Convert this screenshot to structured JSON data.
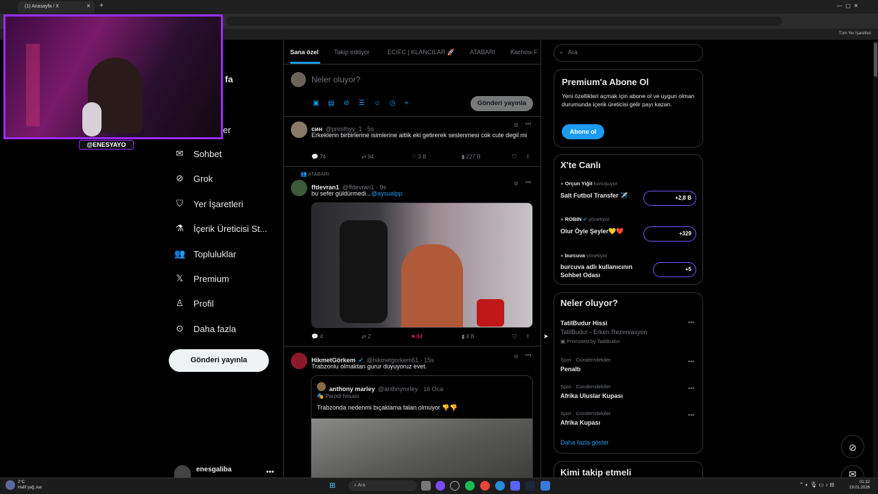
{
  "browser": {
    "tab_title": "(1) Anasayfa / X",
    "bookmarks_label": "Tüm Yer İşaretleri"
  },
  "stream": {
    "cam_name": "@ENESYAYO"
  },
  "sidebar": {
    "partial_home": "fa",
    "partial_notifications": "er",
    "items": [
      {
        "label": "Sohbet",
        "icon": "mail-icon"
      },
      {
        "label": "Grok",
        "icon": "grok-icon"
      },
      {
        "label": "Yer İşaretleri",
        "icon": "bookmark-icon"
      },
      {
        "label": "İçerik Üreticisi St...",
        "icon": "flask-icon"
      },
      {
        "label": "Topluluklar",
        "icon": "people-icon"
      },
      {
        "label": "Premium",
        "icon": "x-icon"
      },
      {
        "label": "Profil",
        "icon": "person-icon"
      },
      {
        "label": "Daha fazla",
        "icon": "more-circle-icon"
      }
    ],
    "post_button": "Gönderi yayınla",
    "account_name": "enesgaliba"
  },
  "feed": {
    "tabs": [
      "Sana özel",
      "Takip ediliyor",
      "ECIFC | KLANCILAR 🚀",
      "ATABARI",
      "Kachow F"
    ],
    "compose_placeholder": "Neler oluyor?",
    "compose_button": "Gönderi yayınla",
    "tweets": [
      {
        "name": "син",
        "handle": "@presthyy_1 · 5s",
        "text": "Erkeklerin birbirlerine isimlerine aitlik eki getirerek seslenmesi cok cute degil mi",
        "replies": "74",
        "reposts": "94",
        "likes": "3 B",
        "views": "227 B"
      },
      {
        "context": "ATABARI",
        "name": "ffdevran1",
        "handle": "@ffdevran1 · 9s",
        "text": "bu sefer güldürmedi...",
        "mention": "@aysualpp",
        "replies": "4",
        "reposts": "2",
        "likes": "84",
        "views": "4 B"
      },
      {
        "name": "HikmetGörkem",
        "handle": "@hikmetgorkem61 · 15s",
        "text": "Trabzonlu olmaktan gurur duyuyoruz evet.",
        "quote": {
          "name": "anthony marley",
          "handle": "@anthnymrley · 16 Oca",
          "label": "Parodi hesabı",
          "text": "Trabzonda nedenmi bıçaklama falan olmuyor 👎👎"
        }
      }
    ]
  },
  "right": {
    "search_placeholder": "Ara",
    "premium": {
      "title": "Premium'a Abone Ol",
      "text": "Yeni özellikleri açmak için abone ol ve uygun olman durumunda içerik üreticisi gelir payı kazan.",
      "button": "Abone ol"
    },
    "live": {
      "title": "X'te Canlı",
      "spaces": [
        {
          "host": "Orçun Yiğit",
          "role": "konuşuyor",
          "title": "Salt Futbol Transfer ✈️",
          "count": "+2,8 B"
        },
        {
          "host": "ROBIN",
          "role": "yönetiyor",
          "title": "Olur Öyle Şeyler💛❤️",
          "count": "+329"
        },
        {
          "host": "burcuva",
          "role": "yönetiyor",
          "title": "burcuva adlı kullanıcının Sohbet Odası",
          "count": "+5"
        }
      ]
    },
    "trends": {
      "title": "Neler oluyor?",
      "items": [
        {
          "category": "",
          "name": "TatilBudur Hissi",
          "sub": "TatilBudur - Erken Rezervasyon",
          "promo": "Promoted by TatilBudur"
        },
        {
          "category": "Spor · Gündemdekiler",
          "name": "Penaltı"
        },
        {
          "category": "Spor · Gündemdekiler",
          "name": "Afrika Uluslar Kupası"
        },
        {
          "category": "Spor · Gündemdekiler",
          "name": "Afrika Kupası"
        }
      ],
      "show_more": "Daha fazla göster"
    },
    "who_to_follow": "Kimi takip etmeli"
  },
  "taskbar": {
    "search": "Ara",
    "weather_temp": "2°C",
    "weather_desc": "Hafif yağ..kar",
    "time": "01:32",
    "date": "19.01.2026"
  },
  "colors": {
    "accent": "#1d9bf0",
    "stream_border": "#9b2cff",
    "like": "#f91880"
  }
}
